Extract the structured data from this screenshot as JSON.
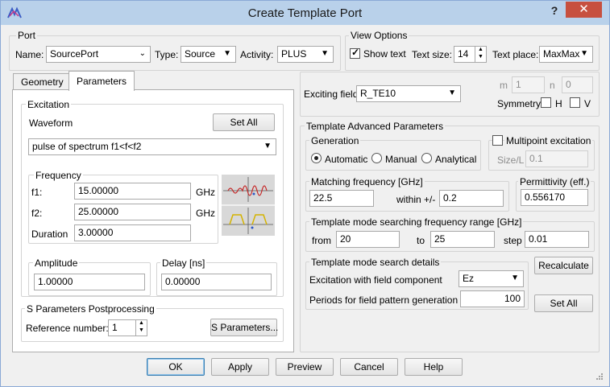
{
  "window": {
    "title": "Create Template Port",
    "help": "?",
    "close": "✕"
  },
  "port": {
    "group": "Port",
    "name_label": "Name:",
    "name_value": "SourcePort",
    "type_label": "Type:",
    "type_value": "Source",
    "activity_label": "Activity:",
    "activity_value": "PLUS"
  },
  "view": {
    "group": "View Options",
    "show_text": "Show text",
    "show_text_checked": true,
    "text_size_label": "Text size:",
    "text_size": "14",
    "text_place_label": "Text place:",
    "text_place": "MaxMax"
  },
  "tabs": [
    "Geometry",
    "Parameters"
  ],
  "excitation": {
    "group": "Excitation",
    "waveform_label": "Waveform",
    "set_all": "Set All",
    "waveform_value": "pulse of spectrum f1<f<f2"
  },
  "frequency": {
    "group": "Frequency",
    "f1_label": "f1:",
    "f1": "15.00000",
    "f1_unit": "GHz",
    "f2_label": "f2:",
    "f2": "25.00000",
    "f2_unit": "GHz",
    "duration_label": "Duration",
    "duration": "3.00000"
  },
  "amplitude": {
    "group": "Amplitude",
    "value": "1.00000"
  },
  "delay": {
    "group": "Delay [ns]",
    "value": "0.00000"
  },
  "sparams": {
    "group": "S Parameters Postprocessing",
    "ref_label": "Reference number:",
    "ref_value": "1",
    "button": "S Parameters..."
  },
  "field": {
    "label": "Exciting field",
    "value": "R_TE10",
    "m_label": "m",
    "m": "1",
    "n_label": "n",
    "n": "0",
    "symmetry_label": "Symmetry",
    "h": "H",
    "v": "V"
  },
  "advanced": {
    "group": "Template Advanced Parameters",
    "generation": {
      "group": "Generation",
      "automatic": "Automatic",
      "manual": "Manual",
      "analytical": "Analytical",
      "selected": "Automatic"
    },
    "multipoint": "Multipoint excitation",
    "size_label": "Size/L",
    "size": "0.1",
    "matching": {
      "group": "Matching frequency [GHz]",
      "value": "22.5",
      "within_label": "within +/-",
      "within": "0.2"
    },
    "permittivity": {
      "group": "Permittivity (eff.)",
      "value": "0.556170"
    },
    "range": {
      "group": "Template mode searching frequency range [GHz]",
      "from_label": "from",
      "from": "20",
      "to_label": "to",
      "to": "25",
      "step_label": "step",
      "step": "0.01"
    },
    "details": {
      "group": "Template mode search details",
      "component_label": "Excitation with field component",
      "component": "Ez",
      "periods_label": "Periods for field pattern generation",
      "periods": "100"
    },
    "recalculate": "Recalculate",
    "set_all": "Set All"
  },
  "footer": {
    "ok": "OK",
    "apply": "Apply",
    "preview": "Preview",
    "cancel": "Cancel",
    "help": "Help"
  }
}
